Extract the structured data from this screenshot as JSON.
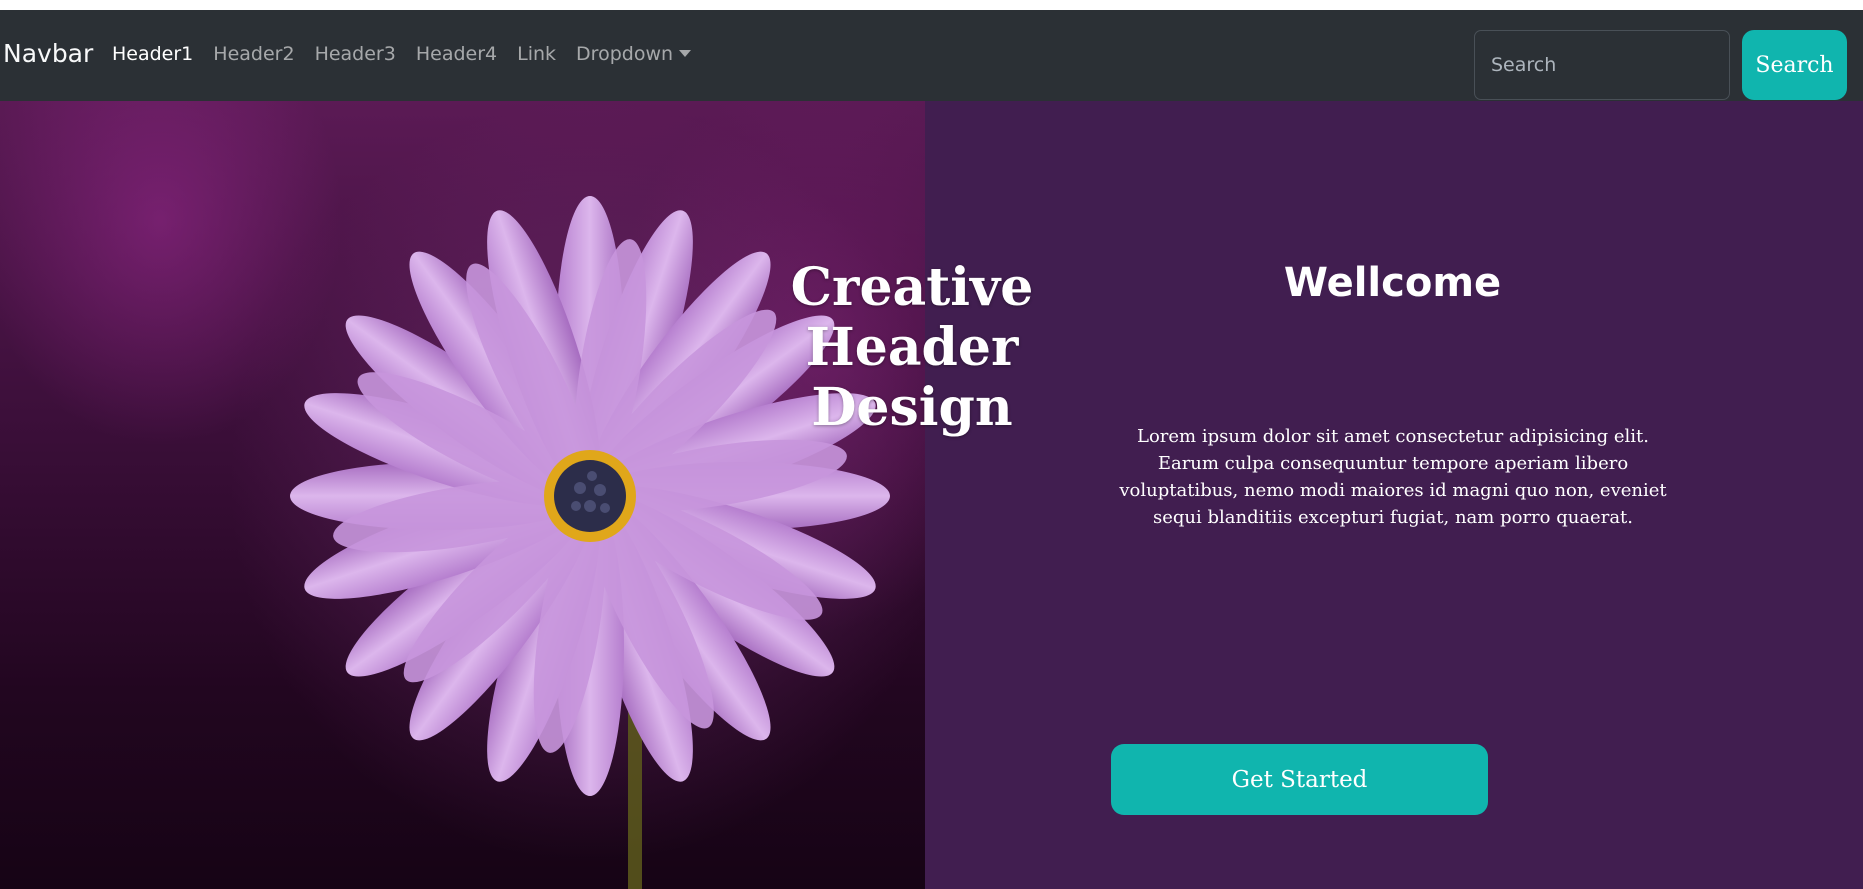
{
  "navbar": {
    "brand": "Navbar",
    "links": [
      {
        "label": "Header1",
        "active": true
      },
      {
        "label": "Header2",
        "active": false
      },
      {
        "label": "Header3",
        "active": false
      },
      {
        "label": "Header4",
        "active": false
      },
      {
        "label": "Link",
        "active": false
      }
    ],
    "dropdown_label": "Dropdown",
    "search": {
      "placeholder": "Search",
      "button_label": "Search"
    }
  },
  "hero": {
    "image_title": "Creative Header Design",
    "welcome_title": "Wellcome",
    "body_text": "Lorem ipsum dolor sit amet consectetur adipisicing elit. Earum culpa consequuntur tempore aperiam libero voluptatibus, nemo modi maiores id magni quo non, eveniet sequi blanditiis excepturi fugiat, nam porro quaerat.",
    "cta_label": "Get Started"
  },
  "colors": {
    "navbar_bg": "#2b3035",
    "accent": "#10b5ae",
    "hero_panel": "#411e50"
  },
  "icons": {
    "dropdown_caret": "chevron-down-icon"
  }
}
